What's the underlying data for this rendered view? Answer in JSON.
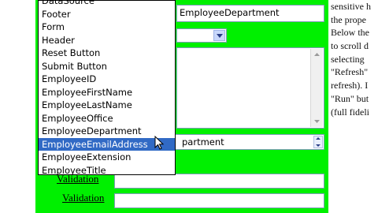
{
  "top_input": {
    "value": "EmployeeDepartment"
  },
  "combo_small": {
    "value": ""
  },
  "textarea": {
    "value": ""
  },
  "combo_large": {
    "value": "partment"
  },
  "labels": {
    "validation_1": "Validation",
    "validation_2": "Validation"
  },
  "dropdown": {
    "items": [
      "DataSource",
      "Footer",
      "Form",
      "Header",
      "Reset Button",
      "Submit Button",
      "EmployeeID",
      "EmployeeFirstName",
      "EmployeeLastName",
      "EmployeeOffice",
      "EmployeeDepartment",
      "EmployeeEmailAddress",
      "EmployeeExtension",
      "EmployeeTitle"
    ],
    "selected_index": 11
  },
  "side_text": {
    "lines": [
      "sensitive h",
      "the prope",
      "Below the",
      "to scroll d",
      "selecting",
      "\"Refresh\"",
      "refresh). I",
      "\"Run\" but",
      "(full fideli"
    ]
  },
  "colors": {
    "panel": "#00f000",
    "selection": "#316ac5"
  }
}
